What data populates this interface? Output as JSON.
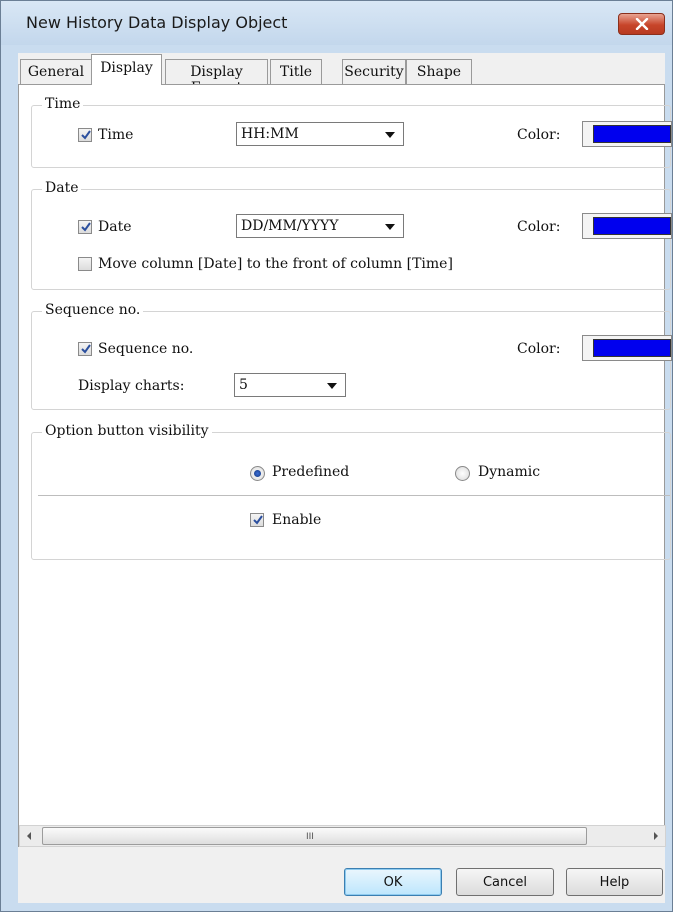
{
  "window": {
    "title": "New History Data Display Object",
    "close_icon": "close-x-icon"
  },
  "tabs": [
    {
      "label": "General",
      "active": false
    },
    {
      "label": "Display",
      "active": true
    },
    {
      "label": "Display Format",
      "active": false
    },
    {
      "label": "Title",
      "active": false
    },
    {
      "label": "Security",
      "active": false
    },
    {
      "label": "Shape",
      "active": false
    }
  ],
  "time_group": {
    "title": "Time",
    "checkbox_label": "Time",
    "checked": true,
    "format_value": "HH:MM",
    "color_label": "Color:",
    "color": "#0000ee"
  },
  "date_group": {
    "title": "Date",
    "checkbox_label": "Date",
    "checked": true,
    "format_value": "DD/MM/YYYY",
    "color_label": "Color:",
    "color": "#0000ee",
    "move_label": "Move column [Date] to the front of column [Time]",
    "move_checked": false
  },
  "sequence_group": {
    "title": "Sequence no.",
    "checkbox_label": "Sequence no.",
    "checked": true,
    "color_label": "Color:",
    "color": "#0000ee",
    "display_charts_label": "Display charts:",
    "display_charts_value": "5"
  },
  "option_group": {
    "title": "Option button visibility",
    "radio_predefined": "Predefined",
    "radio_dynamic": "Dynamic",
    "selected": "Predefined",
    "enable_label": "Enable",
    "enable_checked": true
  },
  "scrollbar": {
    "grip": "III"
  },
  "buttons": {
    "ok": "OK",
    "cancel": "Cancel",
    "help": "Help"
  }
}
